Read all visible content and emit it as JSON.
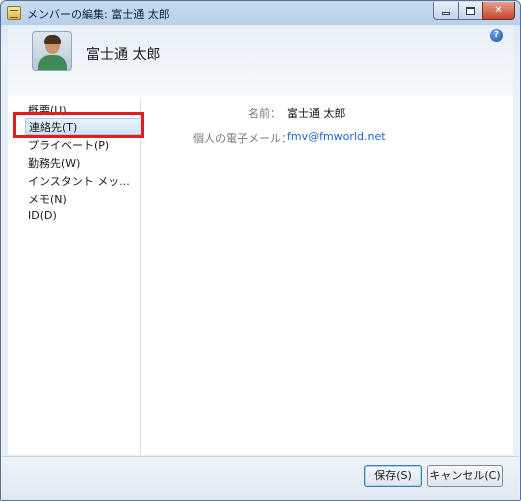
{
  "window": {
    "title": "メンバーの編集: 富士通 太郎",
    "controls": {
      "minimize": "minimize",
      "maximize": "maximize",
      "close": "✕"
    }
  },
  "header": {
    "name": "富士通 太郎",
    "help": "?"
  },
  "sidebar": {
    "items": [
      {
        "label": "概要(U)"
      },
      {
        "label": "連絡先(T)",
        "selected": true
      },
      {
        "label": "プライベート(P)"
      },
      {
        "label": "勤務先(W)"
      },
      {
        "label": "インスタント メッ..."
      },
      {
        "label": "メモ(N)"
      },
      {
        "label": "ID(D)"
      }
    ]
  },
  "details": {
    "name_label": "名前：",
    "name_value": "富士通 太郎",
    "email_label": "個人の電子メール：",
    "email_value": "fmv@fmworld.net"
  },
  "footer": {
    "save_label": "保存(S)",
    "cancel_label": "キャンセル(C)"
  },
  "colors": {
    "accent": "#1f64c8",
    "highlight_box": "#e41c1c",
    "selection": "#cfe3f7"
  },
  "icons": {
    "avatar": "person-avatar-icon",
    "help": "help-icon",
    "app": "app-icon"
  }
}
